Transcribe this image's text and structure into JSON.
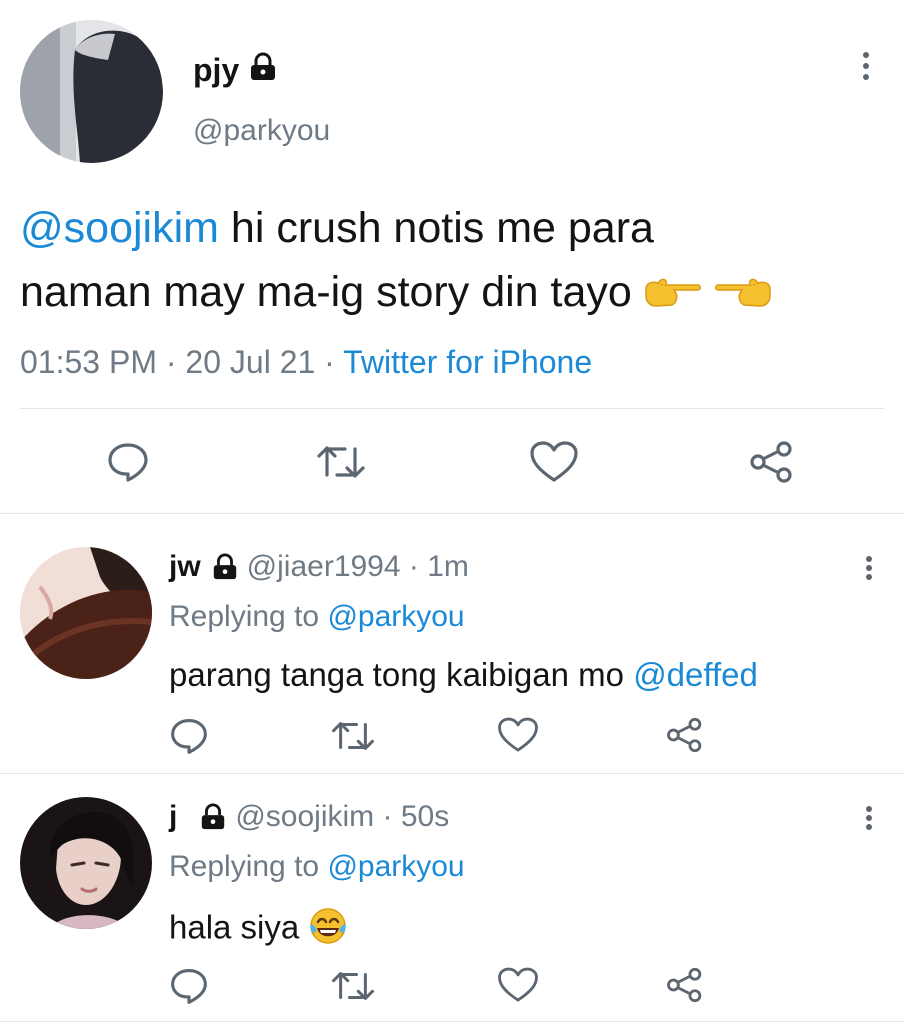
{
  "main_tweet": {
    "author_name": "pjy",
    "author_handle": "@parkyou",
    "text_mention": "@soojikim",
    "text_line1": " hi crush notis me para",
    "text_line2": "naman may ma-ig story din tayo",
    "time": "01:53 PM",
    "date": "20 Jul 21",
    "separator": " · ",
    "source": "Twitter for iPhone"
  },
  "replies": [
    {
      "author_name": "jw",
      "author_handle": "@jiaer1994",
      "time_ago": "1m",
      "replying_prefix": "Replying to ",
      "replying_to": "@parkyou",
      "text": "parang tanga tong kaibigan mo ",
      "text_mention": "@deffed"
    },
    {
      "author_name": "j",
      "author_handle": "@soojikim",
      "time_ago": "50s",
      "replying_prefix": "Replying to ",
      "replying_to": "@parkyou",
      "text": "hala siya ",
      "text_mention": ""
    }
  ],
  "colors": {
    "link": "#1b8ad6",
    "muted": "#6e7a85",
    "icon": "#5c6670",
    "divider": "#e3e6e9"
  },
  "icons": [
    "lock-icon",
    "more-options-icon",
    "reply-icon",
    "retweet-icon",
    "like-icon",
    "share-icon",
    "pointing-right-emoji",
    "pointing-left-emoji",
    "tears-of-joy-emoji"
  ]
}
